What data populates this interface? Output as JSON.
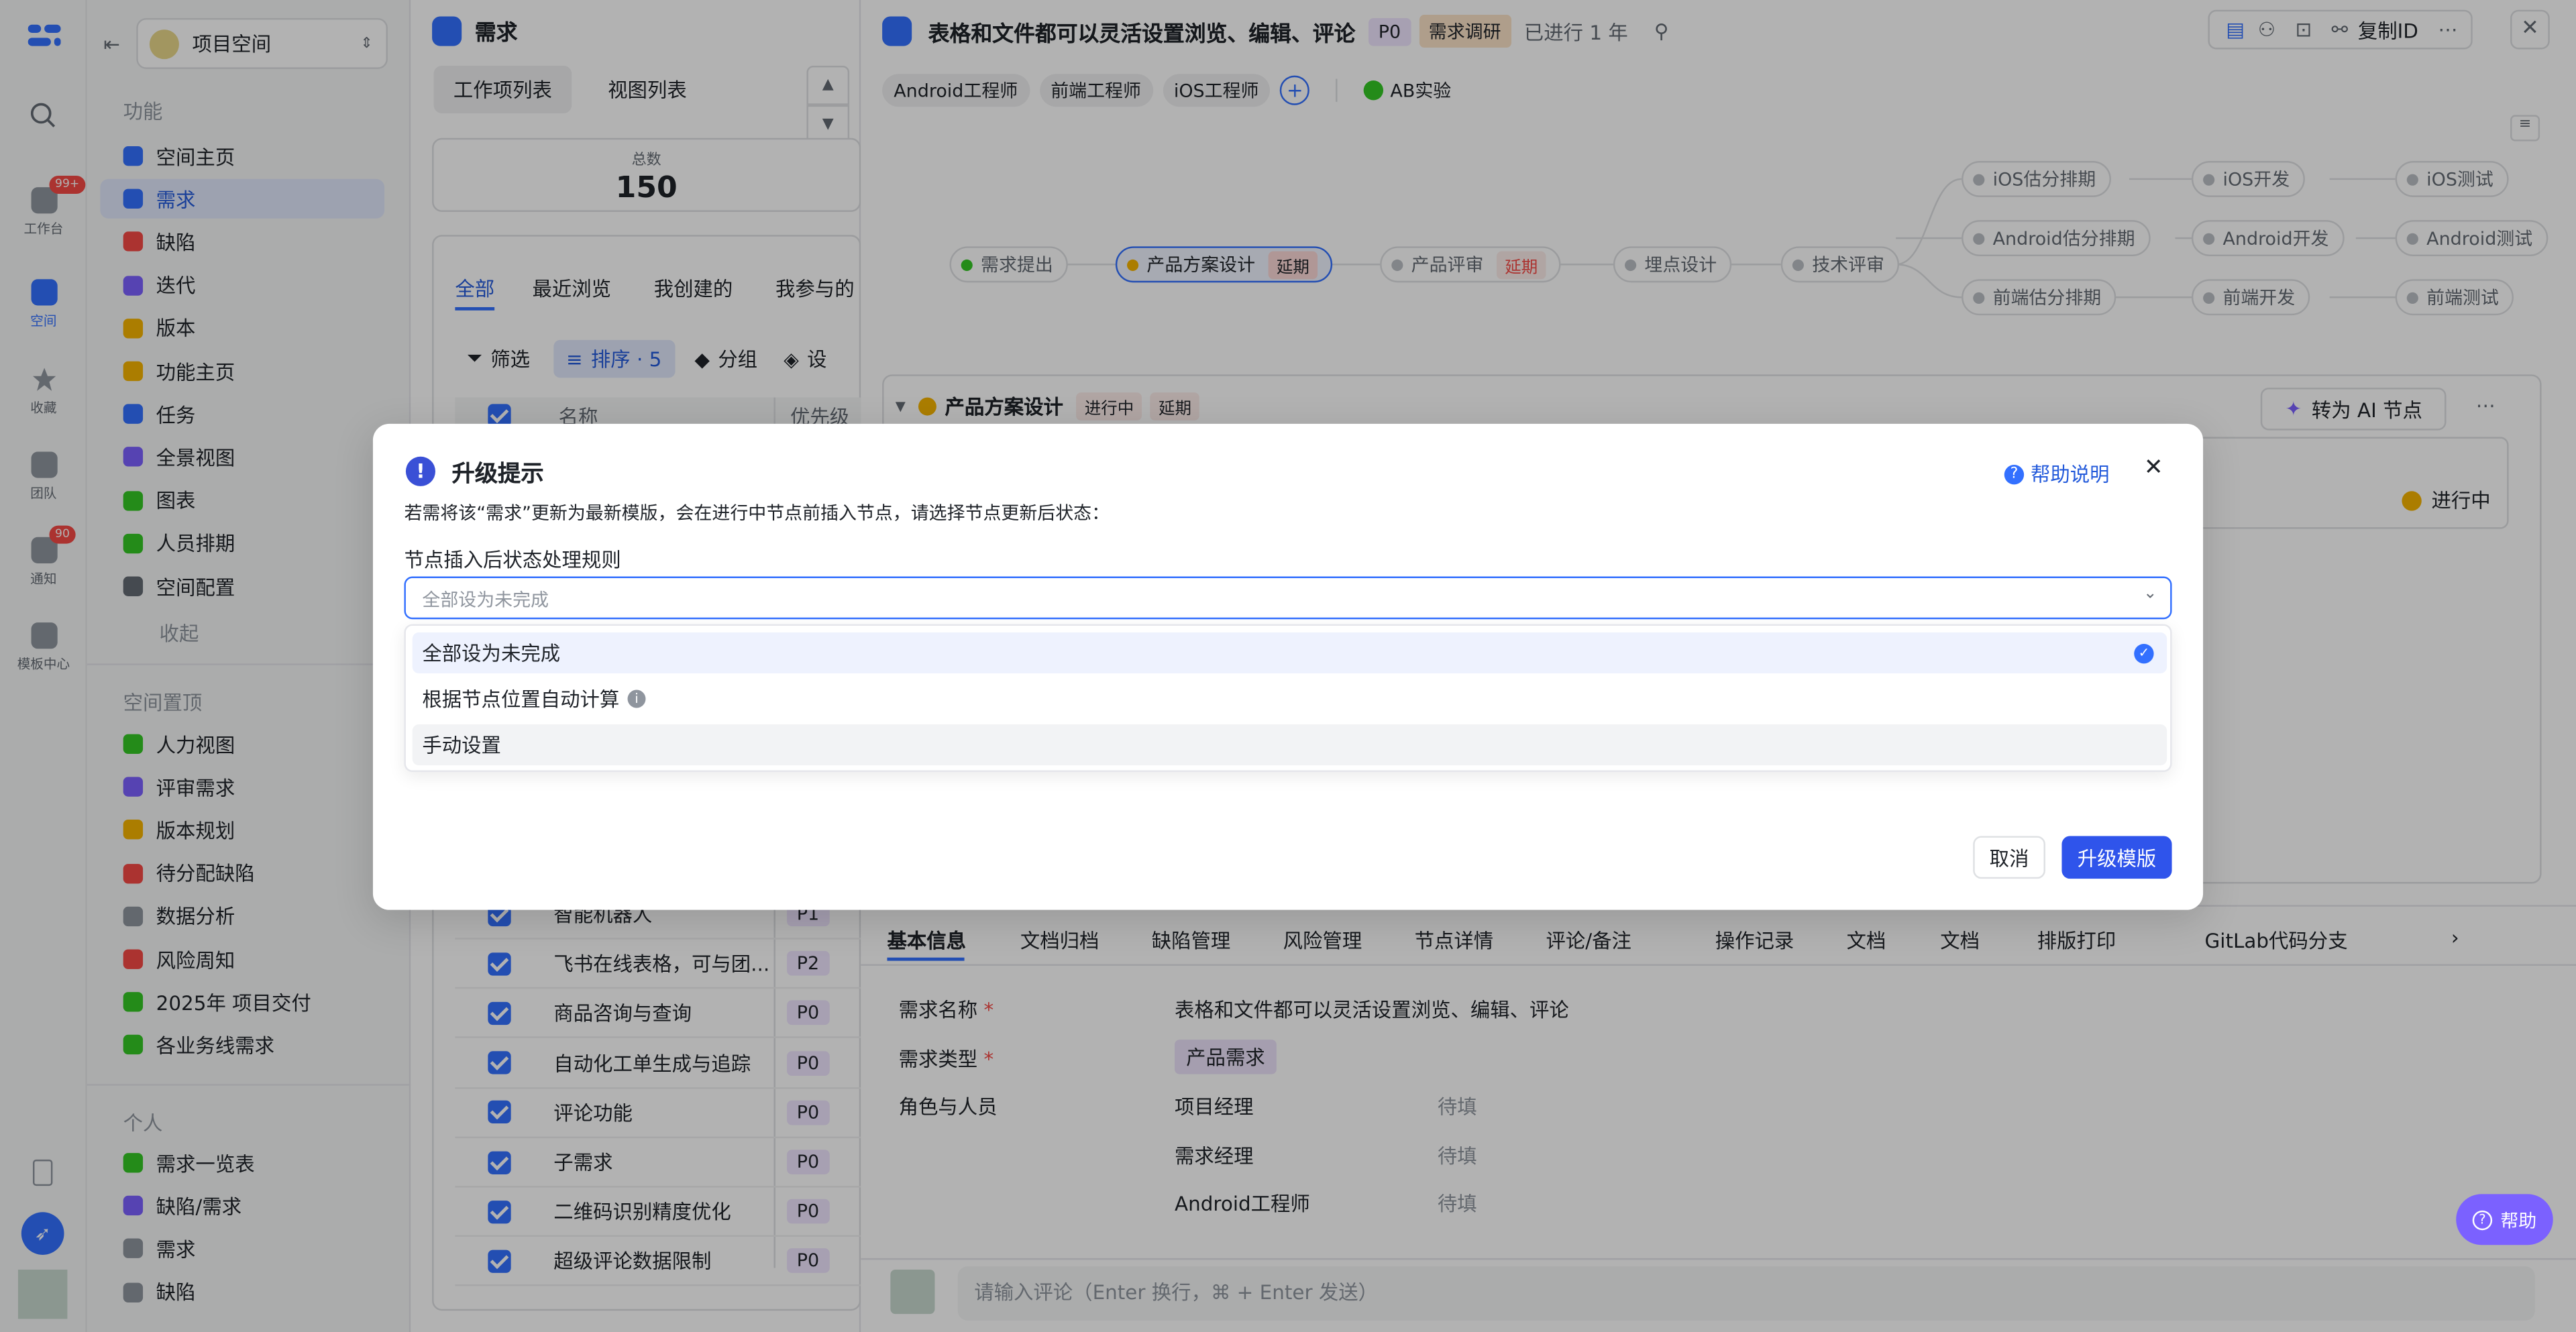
{
  "rail": {
    "items": [
      {
        "label": "工作台",
        "badge": "99+"
      },
      {
        "label": "空间"
      },
      {
        "label": "收藏"
      },
      {
        "label": "团队"
      },
      {
        "label": "通知",
        "badge": "90"
      },
      {
        "label": "模板中心"
      }
    ]
  },
  "sidebar": {
    "space_name": "项目空间",
    "section_features": "功能",
    "features": [
      "空间主页",
      "需求",
      "缺陷",
      "迭代",
      "版本",
      "功能主页",
      "任务",
      "全景视图",
      "图表",
      "人员排期",
      "空间配置"
    ],
    "collapse": "收起",
    "section_pinned": "空间置顶",
    "pinned": [
      "人力视图",
      "评审需求",
      "版本规划",
      "待分配缺陷",
      "数据分析",
      "风险周知",
      "2025年 项目交付",
      "各业务线需求"
    ],
    "section_personal": "个人",
    "personal": [
      "需求一览表",
      "缺陷/需求",
      "需求",
      "缺陷"
    ]
  },
  "list": {
    "title": "需求",
    "tabs": [
      "工作项列表",
      "视图列表"
    ],
    "total_label": "总数",
    "total_value": "150",
    "filters": [
      "全部",
      "最近浏览",
      "我创建的",
      "我参与的"
    ],
    "toolbar": {
      "filter": "筛选",
      "sort": "排序 · 5",
      "group": "分组",
      "settings": "设"
    },
    "col_name": "名称",
    "col_priority": "优先级",
    "rows": [
      {
        "name": "智能机器人",
        "priority": "P1"
      },
      {
        "name": "飞书在线表格，可与团...",
        "priority": "P2"
      },
      {
        "name": "商品咨询与查询",
        "priority": "P0"
      },
      {
        "name": "自动化工单生成与追踪",
        "priority": "P0"
      },
      {
        "name": "评论功能",
        "priority": "P0"
      },
      {
        "name": "子需求",
        "priority": "P0"
      },
      {
        "name": "二维码识别精度优化",
        "priority": "P0"
      },
      {
        "name": "超级评论数据限制",
        "priority": "P0"
      }
    ]
  },
  "detail": {
    "title": "表格和文件都可以灵活设置浏览、编辑、评论",
    "priority": "P0",
    "stage": "需求调研",
    "elapsed": "已进行 1 年",
    "copy_id": "复制ID",
    "role_tags": [
      "Android工程师",
      "前端工程师",
      "iOS工程师"
    ],
    "ab_label": "AB实验",
    "nodes": {
      "n1": "需求提出",
      "n2": "产品方案设计",
      "n2_badge": "延期",
      "n3": "产品评审",
      "n3_badge": "延期",
      "n4": "埋点设计",
      "n5": "技术评审",
      "ios": [
        "iOS估分排期",
        "iOS开发",
        "iOS测试"
      ],
      "android": [
        "Android估分排期",
        "Android开发",
        "Android测试"
      ],
      "fe": [
        "前端估分排期",
        "前端开发",
        "前端测试"
      ]
    },
    "node_panel": {
      "title": "产品方案设计",
      "status": "进行中",
      "delay": "延期",
      "ai_button": "转为 AI 节点",
      "state": "进行中"
    },
    "tabs": [
      "基本信息",
      "文档归档",
      "缺陷管理",
      "风险管理",
      "节点详情",
      "评论/备注",
      "操作记录",
      "文档",
      "文档",
      "排版打印",
      "GitLab代码分支"
    ],
    "fields": {
      "name_label": "需求名称",
      "name_value": "表格和文件都可以灵活设置浏览、编辑、评论",
      "type_label": "需求类型",
      "type_value": "产品需求",
      "roles_label": "角色与人员",
      "roles": [
        {
          "role": "项目经理",
          "value": "待填"
        },
        {
          "role": "需求经理",
          "value": "待填"
        },
        {
          "role": "Android工程师",
          "value": "待填"
        }
      ]
    },
    "comment_placeholder": "请输入评论（Enter 换行，⌘ + Enter 发送）",
    "help": "帮助"
  },
  "modal": {
    "title": "升级提示",
    "help_link": "帮助说明",
    "description": "若需将该“需求”更新为最新模版，会在进行中节点前插入节点，请选择节点更新后状态：",
    "field_label": "节点插入后状态处理规则",
    "select_placeholder": "全部设为未完成",
    "options": [
      "全部设为未完成",
      "根据节点位置自动计算",
      "手动设置"
    ],
    "cancel": "取消",
    "confirm": "升级模版"
  },
  "colors": {
    "accent": "#3370ff",
    "confirm": "#2f54eb",
    "danger": "#f54a45"
  }
}
